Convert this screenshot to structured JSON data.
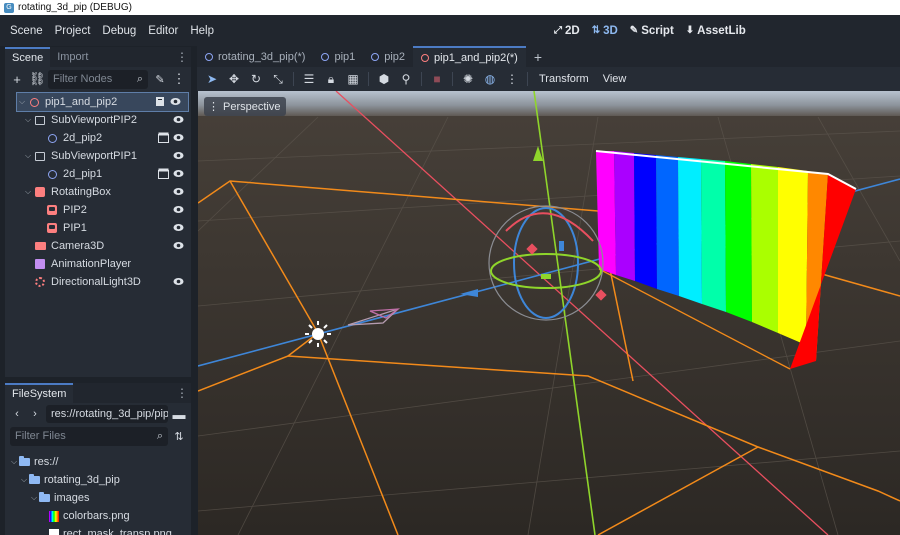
{
  "window": {
    "title": "rotating_3d_pip (DEBUG)"
  },
  "menu": [
    "Scene",
    "Project",
    "Debug",
    "Editor",
    "Help"
  ],
  "modes": [
    {
      "label": "2D",
      "active": false
    },
    {
      "label": "3D",
      "active": true
    },
    {
      "label": "Script",
      "active": false
    },
    {
      "label": "AssetLib",
      "active": false
    }
  ],
  "scene_dock": {
    "tabs": [
      "Scene",
      "Import"
    ],
    "filter_placeholder": "Filter Nodes",
    "nodes": [
      {
        "name": "pip1_and_pip2",
        "depth": 0,
        "icon": "node3d-icon",
        "visible": true
      },
      {
        "name": "SubViewportPIP2",
        "depth": 1,
        "icon": "subviewport-icon",
        "visible": true
      },
      {
        "name": "2d_pip2",
        "depth": 2,
        "icon": "node2d-icon",
        "visible": true,
        "scene": true
      },
      {
        "name": "SubViewportPIP1",
        "depth": 1,
        "icon": "subviewport-icon",
        "visible": true
      },
      {
        "name": "2d_pip1",
        "depth": 2,
        "icon": "node2d-icon",
        "visible": true,
        "scene": true
      },
      {
        "name": "RotatingBox",
        "depth": 1,
        "icon": "box-icon",
        "visible": true
      },
      {
        "name": "PIP2",
        "depth": 2,
        "icon": "mesh-icon",
        "visible": true
      },
      {
        "name": "PIP1",
        "depth": 2,
        "icon": "mesh-icon",
        "visible": true
      },
      {
        "name": "Camera3D",
        "depth": 1,
        "icon": "camera-icon",
        "visible": true
      },
      {
        "name": "AnimationPlayer",
        "depth": 1,
        "icon": "animation-icon",
        "visible": false
      },
      {
        "name": "DirectionalLight3D",
        "depth": 1,
        "icon": "light-icon",
        "visible": true
      }
    ]
  },
  "filesystem_dock": {
    "tab": "FileSystem",
    "path": "res://rotating_3d_pip/pip1_",
    "filter_placeholder": "Filter Files",
    "items": [
      {
        "name": "res://",
        "type": "folder"
      },
      {
        "name": "rotating_3d_pip",
        "type": "folder"
      },
      {
        "name": "images",
        "type": "folder"
      },
      {
        "name": "colorbars.png",
        "type": "image"
      },
      {
        "name": "rect_mask_transp.png",
        "type": "image"
      }
    ]
  },
  "scene_tabs": [
    {
      "label": "rotating_3d_pip(*)",
      "active": false
    },
    {
      "label": "pip1",
      "active": false
    },
    {
      "label": "pip2",
      "active": false
    },
    {
      "label": "pip1_and_pip2(*)",
      "active": true
    }
  ],
  "viewport_toolbar": {
    "transform_label": "Transform",
    "view_label": "View"
  },
  "viewport": {
    "perspective_label": "Perspective"
  },
  "colors": {
    "accent": "#4c7bc4",
    "x_axis": "#e84f5f",
    "y_axis": "#8fd52b",
    "z_axis": "#3e86d8",
    "selection": "#f28a1a"
  }
}
